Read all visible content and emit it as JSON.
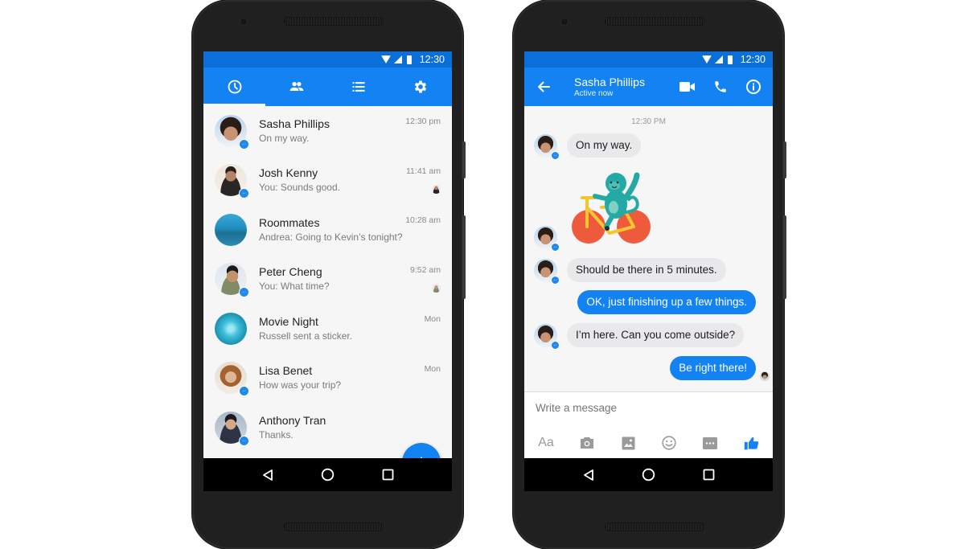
{
  "colors": {
    "brand_blue": "#1382f3",
    "status_blue": "#0a6fd9",
    "phone_body": "#202020",
    "bubble_in": "#e9e9eb",
    "bubble_out": "#1382f3"
  },
  "status_bar": {
    "time": "12:30",
    "icons": [
      "wifi-icon",
      "signal-icon",
      "battery-icon"
    ]
  },
  "conversations_screen": {
    "tabs": [
      {
        "name": "recent",
        "icon": "clock-icon",
        "active": true
      },
      {
        "name": "people",
        "icon": "people-icon",
        "active": false
      },
      {
        "name": "groups",
        "icon": "list-icon",
        "active": false
      },
      {
        "name": "settings",
        "icon": "gear-icon",
        "active": false
      }
    ],
    "conversations": [
      {
        "name": "Sasha Phillips",
        "preview": "On my way.",
        "time": "12:30 pm",
        "messenger_badge": true,
        "seen_avatar": false
      },
      {
        "name": "Josh Kenny",
        "preview": "You: Sounds good.",
        "time": "11:41 am",
        "messenger_badge": true,
        "seen_avatar": true
      },
      {
        "name": "Roommates",
        "preview": "Andrea: Going to Kevin’s tonight?",
        "time": "10:28 am",
        "messenger_badge": false,
        "seen_avatar": false
      },
      {
        "name": "Peter Cheng",
        "preview": "You: What time?",
        "time": "9:52 am",
        "messenger_badge": true,
        "seen_avatar": true
      },
      {
        "name": "Movie Night",
        "preview": "Russell sent a sticker.",
        "time": "Mon",
        "messenger_badge": false,
        "seen_avatar": false
      },
      {
        "name": "Lisa Benet",
        "preview": "How was your trip?",
        "time": "Mon",
        "messenger_badge": true,
        "seen_avatar": false
      },
      {
        "name": "Anthony Tran",
        "preview": "Thanks.",
        "time": "",
        "messenger_badge": true,
        "seen_avatar": false
      }
    ],
    "fab": {
      "label": "+",
      "icon": "plus-icon"
    }
  },
  "chat_screen": {
    "contact_name": "Sasha Phillips",
    "contact_status": "Active now",
    "actions": [
      "video-call-icon",
      "phone-icon",
      "info-icon"
    ],
    "timestamp": "12:30 PM",
    "messages": [
      {
        "from": "them",
        "type": "text",
        "text": "On my way."
      },
      {
        "from": "them",
        "type": "sticker",
        "sticker": "monkey-on-bicycle"
      },
      {
        "from": "them",
        "type": "text",
        "text": "Should be there in 5 minutes."
      },
      {
        "from": "me",
        "type": "text",
        "text": "OK, just finishing up a few things."
      },
      {
        "from": "them",
        "type": "text",
        "text": "I’m here. Can you come outside?"
      },
      {
        "from": "me",
        "type": "text",
        "text": "Be right there!"
      }
    ],
    "composer": {
      "placeholder": "Write a message",
      "text_format_label": "Aa",
      "tools": [
        "text-format-icon",
        "camera-icon",
        "image-icon",
        "emoji-icon",
        "more-icon",
        "thumbs-up-icon"
      ]
    }
  },
  "nav_bar": {
    "buttons": [
      "back-triangle-icon",
      "home-circle-icon",
      "recents-square-icon"
    ]
  }
}
